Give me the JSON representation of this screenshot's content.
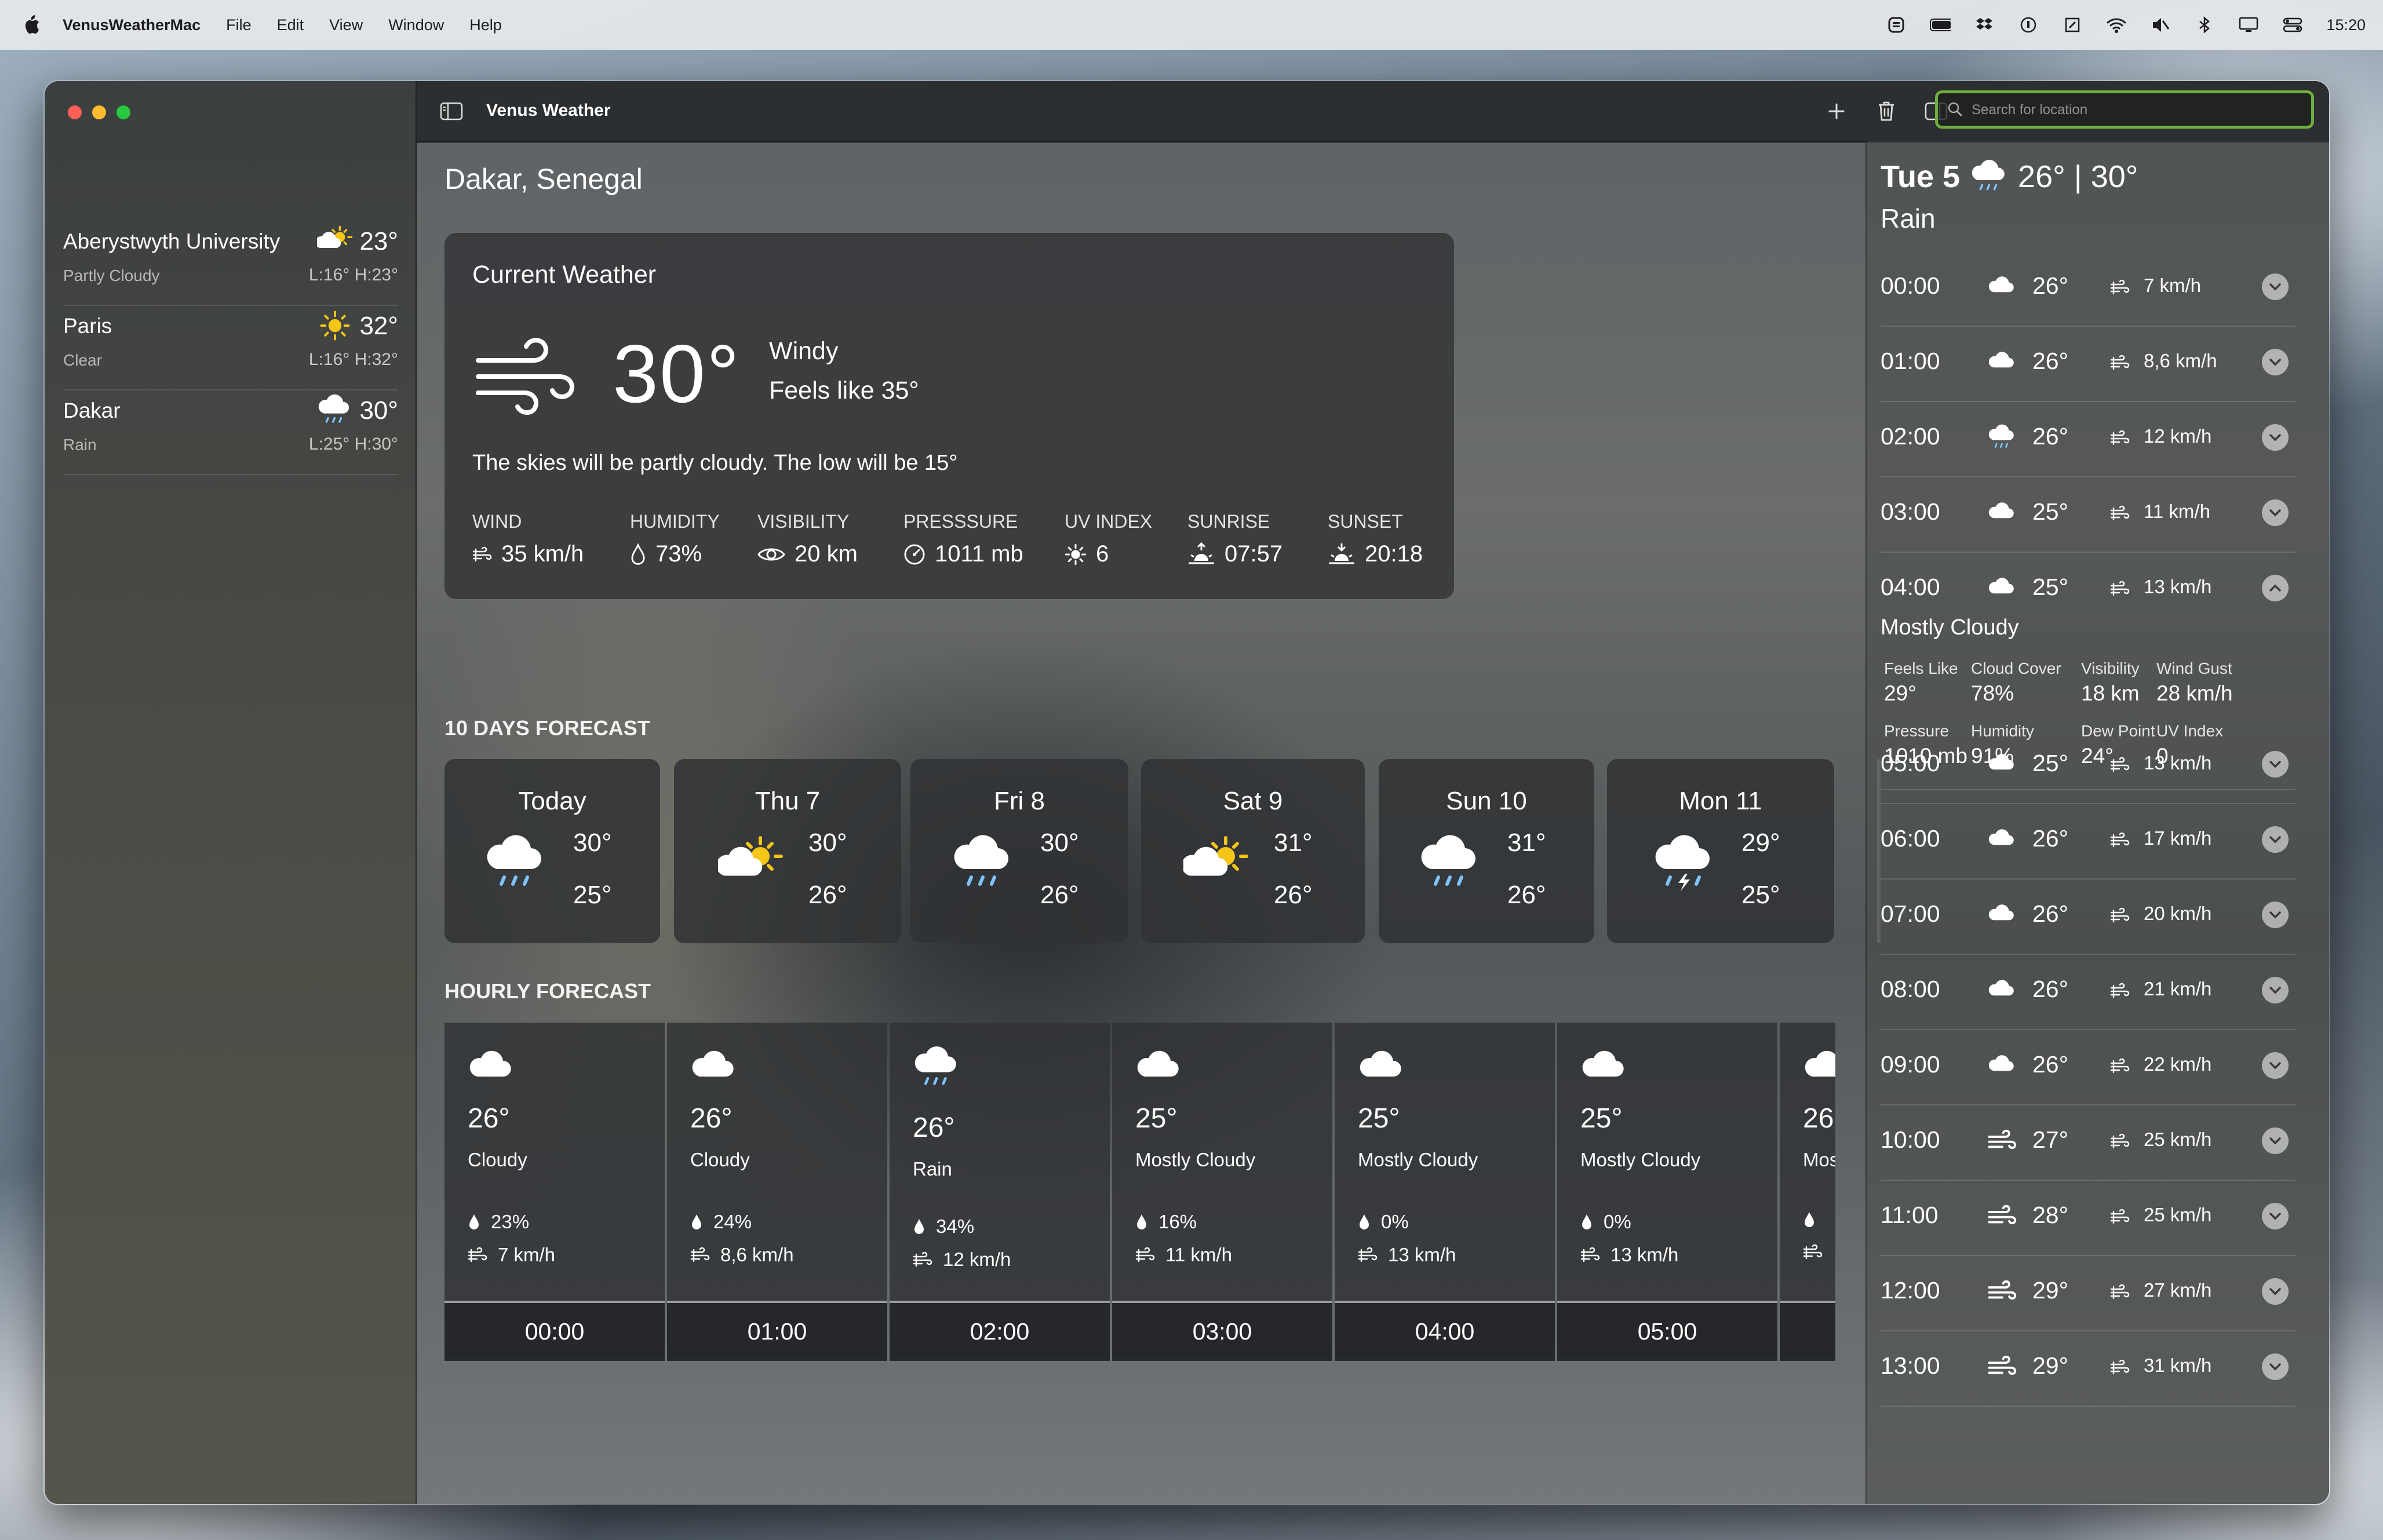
{
  "menubar": {
    "app_name": "VenusWeatherMac",
    "menus": [
      "File",
      "Edit",
      "View",
      "Window",
      "Help"
    ],
    "clock": "15:20"
  },
  "toolbar": {
    "title": "Venus Weather",
    "search_placeholder": "Search for location"
  },
  "sidebar": {
    "locations": [
      {
        "name": "Aberystwyth University",
        "condition": "Partly Cloudy",
        "temp": "23°",
        "lowhigh": "L:16° H:23°",
        "icon": "partly-cloudy-icon"
      },
      {
        "name": "Paris",
        "condition": "Clear",
        "temp": "32°",
        "lowhigh": "L:16° H:32°",
        "icon": "sun-icon"
      },
      {
        "name": "Dakar",
        "condition": "Rain",
        "temp": "30°",
        "lowhigh": "L:25° H:30°",
        "icon": "rain-icon"
      }
    ]
  },
  "main": {
    "city": "Dakar, Senegal",
    "current": {
      "title": "Current Weather",
      "temp": "30°",
      "condition": "Windy",
      "feels_like": "Feels like 35°",
      "description": "The skies will be partly cloudy. The low will be 15°",
      "stats": [
        {
          "label": "WIND",
          "value": "35 km/h",
          "icon": "wind-icon"
        },
        {
          "label": "HUMIDITY",
          "value": "73%",
          "icon": "drop-icon"
        },
        {
          "label": "VISIBILITY",
          "value": "20 km",
          "icon": "eye-icon"
        },
        {
          "label": "PRESSSURE",
          "value": "1011 mb",
          "icon": "gauge-icon"
        },
        {
          "label": "UV INDEX",
          "value": "6",
          "icon": "sun-icon"
        },
        {
          "label": "SUNRISE",
          "value": "07:57",
          "icon": "sunrise-icon"
        },
        {
          "label": "SUNSET",
          "value": "20:18",
          "icon": "sunset-icon"
        }
      ]
    },
    "ten_day_title": "10 DAYS FORECAST",
    "ten_day": [
      {
        "day": "Today",
        "high": "30°",
        "low": "25°",
        "icon": "rain-icon"
      },
      {
        "day": "Thu 7",
        "high": "30°",
        "low": "26°",
        "icon": "partly-cloudy-icon"
      },
      {
        "day": "Fri 8",
        "high": "30°",
        "low": "26°",
        "icon": "rain-icon"
      },
      {
        "day": "Sat 9",
        "high": "31°",
        "low": "26°",
        "icon": "partly-cloudy-icon"
      },
      {
        "day": "Sun 10",
        "high": "31°",
        "low": "26°",
        "icon": "rain-icon"
      },
      {
        "day": "Mon 11",
        "high": "29°",
        "low": "25°",
        "icon": "thunderstorm-icon"
      }
    ],
    "hourly_title": "HOURLY FORECAST",
    "hourly": [
      {
        "time": "00:00",
        "temp": "26°",
        "condition": "Cloudy",
        "precip": "23%",
        "wind": "7 km/h",
        "icon": "cloud-icon"
      },
      {
        "time": "01:00",
        "temp": "26°",
        "condition": "Cloudy",
        "precip": "24%",
        "wind": "8,6 km/h",
        "icon": "cloud-icon"
      },
      {
        "time": "02:00",
        "temp": "26°",
        "condition": "Rain",
        "precip": "34%",
        "wind": "12 km/h",
        "icon": "rain-icon"
      },
      {
        "time": "03:00",
        "temp": "25°",
        "condition": "Mostly Cloudy",
        "precip": "16%",
        "wind": "11 km/h",
        "icon": "cloud-icon"
      },
      {
        "time": "04:00",
        "temp": "25°",
        "condition": "Mostly Cloudy",
        "precip": "0%",
        "wind": "13 km/h",
        "icon": "cloud-icon"
      },
      {
        "time": "05:00",
        "temp": "25°",
        "condition": "Mostly Cloudy",
        "precip": "0%",
        "wind": "13 km/h",
        "icon": "cloud-icon"
      },
      {
        "time": "",
        "temp": "26",
        "condition": "Mos",
        "precip": "",
        "wind": "",
        "icon": "cloud-icon"
      }
    ]
  },
  "detail": {
    "day": "Tue 5",
    "temps": "26° | 30°",
    "condition": "Rain",
    "hours": [
      {
        "time": "00:00",
        "temp": "26°",
        "wind": "7 km/h",
        "icon": "cloud-icon"
      },
      {
        "time": "01:00",
        "temp": "26°",
        "wind": "8,6 km/h",
        "icon": "cloud-icon"
      },
      {
        "time": "02:00",
        "temp": "26°",
        "wind": "12 km/h",
        "icon": "rain-icon"
      },
      {
        "time": "03:00",
        "temp": "25°",
        "wind": "11 km/h",
        "icon": "cloud-icon"
      },
      {
        "time": "04:00",
        "temp": "25°",
        "wind": "13 km/h",
        "icon": "cloud-icon"
      },
      {
        "time": "05:00",
        "temp": "25°",
        "wind": "13 km/h",
        "icon": "cloud-icon"
      },
      {
        "time": "06:00",
        "temp": "26°",
        "wind": "17 km/h",
        "icon": "cloud-icon"
      },
      {
        "time": "07:00",
        "temp": "26°",
        "wind": "20 km/h",
        "icon": "cloud-icon"
      },
      {
        "time": "08:00",
        "temp": "26°",
        "wind": "21 km/h",
        "icon": "cloud-icon"
      },
      {
        "time": "09:00",
        "temp": "26°",
        "wind": "22 km/h",
        "icon": "cloud-icon"
      },
      {
        "time": "10:00",
        "temp": "27°",
        "wind": "25 km/h",
        "icon": "wind-icon"
      },
      {
        "time": "11:00",
        "temp": "28°",
        "wind": "25 km/h",
        "icon": "wind-icon"
      },
      {
        "time": "12:00",
        "temp": "29°",
        "wind": "27 km/h",
        "icon": "wind-icon"
      },
      {
        "time": "13:00",
        "temp": "29°",
        "wind": "31 km/h",
        "icon": "wind-icon"
      }
    ],
    "expanded": {
      "condition": "Mostly Cloudy",
      "items": [
        {
          "label": "Feels Like",
          "value": "29°"
        },
        {
          "label": "Cloud Cover",
          "value": "78%"
        },
        {
          "label": "Visibility",
          "value": "18 km"
        },
        {
          "label": "Wind Gust",
          "value": "28 km/h"
        },
        {
          "label": "Pressure",
          "value": "1010 mb"
        },
        {
          "label": "Humidity",
          "value": "91%"
        },
        {
          "label": "Dew Point",
          "value": "24°"
        },
        {
          "label": "UV Index",
          "value": "0"
        }
      ]
    }
  },
  "colors": {
    "accent_search": "#6fae3e",
    "sun": "#f5c518",
    "rain": "#7ec3ff"
  }
}
